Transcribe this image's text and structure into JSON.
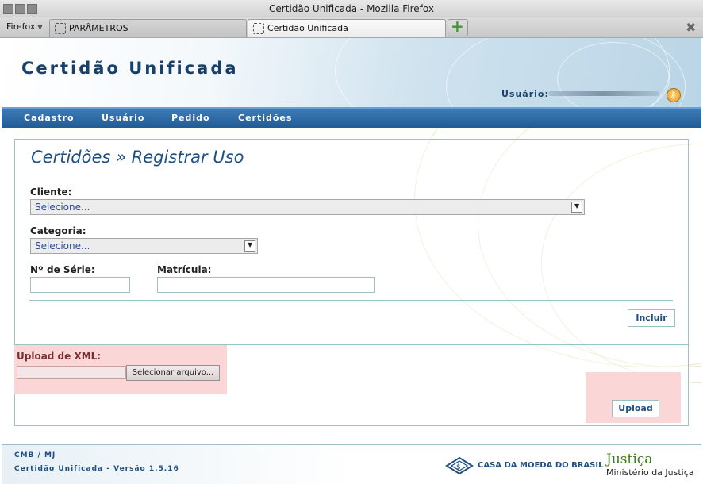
{
  "window": {
    "title": "Certidão Unificada - Mozilla Firefox"
  },
  "browser": {
    "menu_label": "Firefox",
    "tabs": [
      {
        "label": "PARÂMETROS",
        "active": false
      },
      {
        "label": "Certidão Unificada",
        "active": true
      }
    ],
    "new_tab_icon": "plus-icon",
    "close_icon": "close-icon"
  },
  "header": {
    "site_title": "Certidão Unificada",
    "user_label": "Usuário:",
    "user_icon": "key-icon"
  },
  "nav": {
    "items": [
      "Cadastro",
      "Usuário",
      "Pedido",
      "Certidões"
    ]
  },
  "page": {
    "title": "Certidões » Registrar Uso",
    "form": {
      "cliente_label": "Cliente:",
      "cliente_value": "Selecione...",
      "categoria_label": "Categoria:",
      "categoria_value": "Selecione...",
      "serie_label": "Nº de Série:",
      "serie_value": "",
      "matricula_label": "Matrícula:",
      "matricula_value": "",
      "incluir_label": "Incluir"
    },
    "upload": {
      "label": "Upload de XML:",
      "file_value": "",
      "select_file_label": "Selecionar arquivo...",
      "upload_label": "Upload"
    }
  },
  "footer": {
    "org": "CMB / MJ",
    "version_text": "Certidão Unificada - Versão 1.5.16",
    "cmb_name": "CASA DA MOEDA DO BRASIL",
    "justica": "Justiça",
    "ministerio": "Ministério da Justiça"
  },
  "colors": {
    "primary": "#1d4f82",
    "nav_bar": "#2e6aa6",
    "highlight": "#fbd6d7",
    "justica_green": "#3d7a1d"
  }
}
